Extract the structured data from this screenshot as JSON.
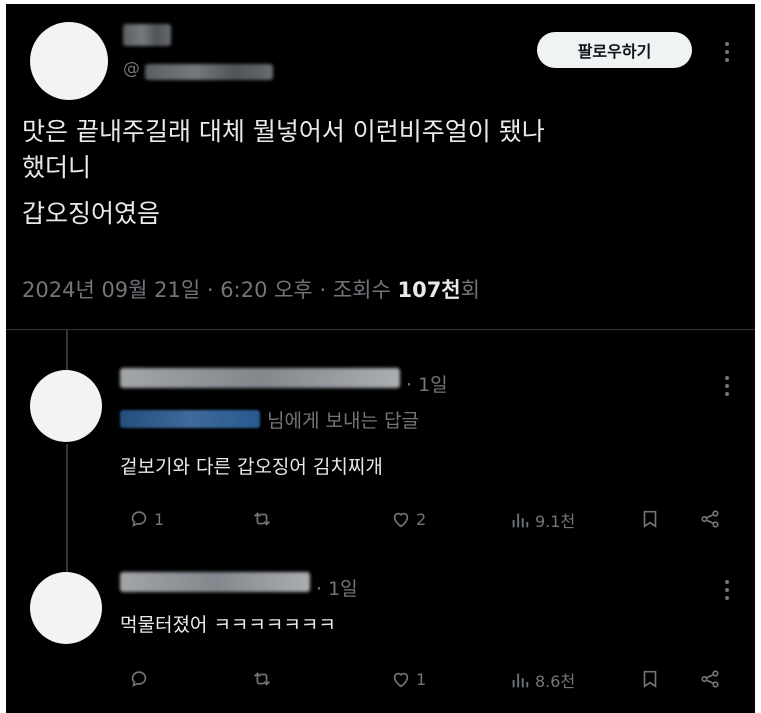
{
  "tweet": {
    "handle_prefix": "@",
    "follow_label": "팔로우하기",
    "text_lines": [
      "맛은 끝내주길래 대체 뭘넣어서 이런비주얼이 됐나",
      "했더니",
      "갑오징어였음"
    ],
    "meta": {
      "date": "2024년 09월 21일",
      "sep1": "·",
      "time": "6:20 오후",
      "sep2": "·",
      "views_prefix": "조회수",
      "views_count": "107천",
      "views_suffix": "회"
    }
  },
  "replies": [
    {
      "time": "· 1일",
      "reply_to_suffix": "님에게 보내는 답글",
      "text": "겉보기와 다른 갑오징어 김치찌개",
      "actions": {
        "comments": "1",
        "retweets": "",
        "likes": "2",
        "views": "9.1천"
      }
    },
    {
      "time": "· 1일",
      "text": "먹물터졌어 ㅋㅋㅋㅋㅋㅋㅋ",
      "actions": {
        "comments": "",
        "retweets": "",
        "likes": "1",
        "views": "8.6천"
      }
    }
  ],
  "colors": {
    "background": "#000000",
    "text": "#e7e9ea",
    "muted": "#71767b",
    "button_bg": "#eff3f4"
  }
}
